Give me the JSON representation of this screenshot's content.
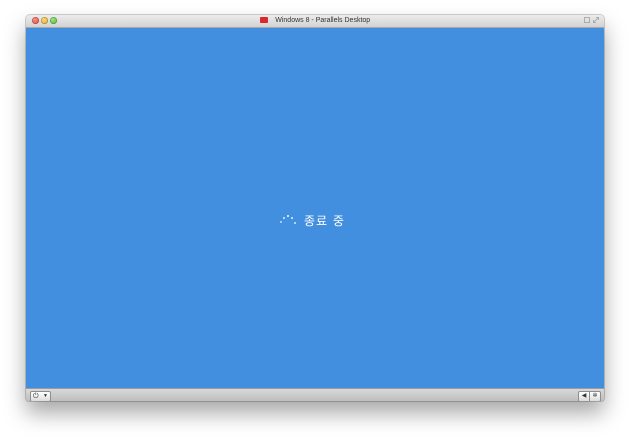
{
  "window": {
    "title": "Windows 8 - Parallels Desktop",
    "app_icon": "parallels-icon"
  },
  "screen": {
    "background_color": "#418fde",
    "status_text": "종료 중",
    "spinner": "loading-spinner-icon"
  },
  "bottombar": {
    "power_icon": "power-icon",
    "left_icon": "speaker-icon",
    "right_icon": "gear-icon"
  }
}
